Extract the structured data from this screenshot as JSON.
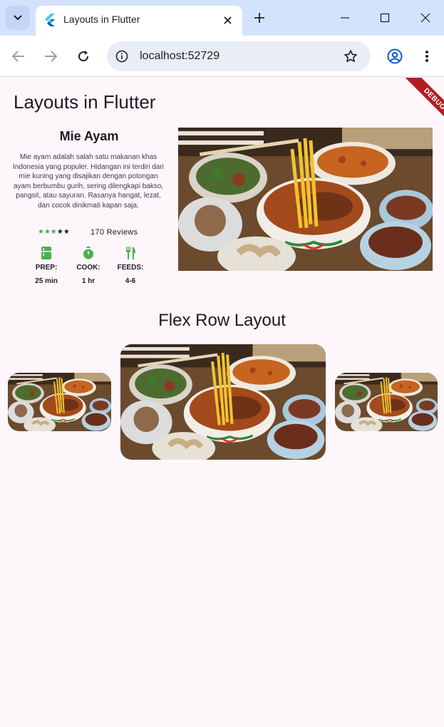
{
  "browser": {
    "tab_title": "Layouts in Flutter",
    "url": "localhost:52729"
  },
  "app": {
    "title": "Layouts in Flutter",
    "debug_label": "DEBUG",
    "recipe": {
      "title": "Mie Ayam",
      "description": "Mie ayam adalah salah satu makanan khas Indonesia yang populer. Hidangan ini terdiri dari mie kuning yang disajikan dengan potongan ayam berbumbu gurih, sering dilengkapi bakso, pangsit, atau sayuran. Rasanya hangat, lezat, dan cocok dinikmati kapan saja.",
      "rating": {
        "filled": 3,
        "total": 5,
        "filled_stars": "★★★",
        "empty_stars": "★★"
      },
      "reviews": "170 Reviews",
      "info": [
        {
          "icon": "kitchen-icon",
          "label": "PREP:",
          "value": "25 min"
        },
        {
          "icon": "timer-icon",
          "label": "COOK:",
          "value": "1 hr"
        },
        {
          "icon": "restaurant-icon",
          "label": "FEEDS:",
          "value": "4-6"
        }
      ]
    },
    "flex_section_title": "Flex Row Layout"
  },
  "colors": {
    "accent_green": "#4caf50",
    "page_background": "#fdf7fc",
    "tabbar_background": "#d3e3fd",
    "debug_banner": "#b11e22"
  }
}
